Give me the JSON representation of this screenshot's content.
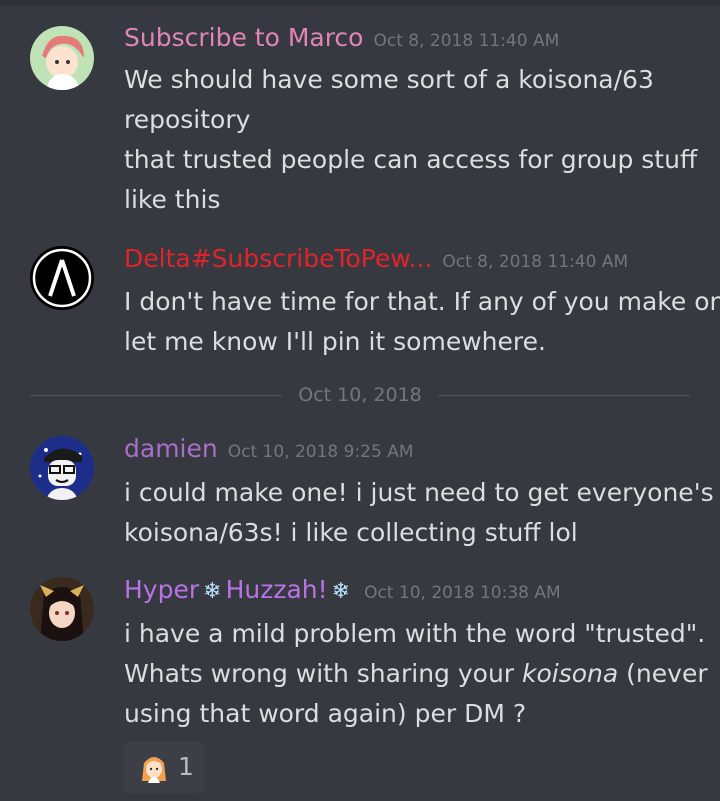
{
  "messages": [
    {
      "username": "Subscribe to Marco",
      "username_color": "#e184b7",
      "timestamp": "Oct 8, 2018 11:40 AM",
      "lines": [
        "We should have some sort of a koisona/63",
        "repository",
        "that trusted people can access for group stuff",
        "like this"
      ]
    },
    {
      "username": "Delta#SubscribeToPew...",
      "username_color": "#e0242a",
      "timestamp": "Oct 8, 2018 11:40 AM",
      "lines": [
        "I don't have time for that. If any of you make one",
        "let me know I'll pin it somewhere."
      ]
    },
    {
      "username": "damien",
      "username_color": "#a86fc9",
      "timestamp": "Oct 10, 2018 9:25 AM",
      "lines": [
        "i could make one! i just need to get everyone's",
        "koisona/63s! i like collecting stuff lol"
      ]
    },
    {
      "username_parts": [
        "Hyper",
        "Huzzah!"
      ],
      "username_color": "#b873e5",
      "username_icon": "snowflake-icon",
      "timestamp": "Oct 10, 2018 10:38 AM",
      "line1": "i have a mild problem with the word \"trusted\".",
      "line2_pre": "Whats wrong with sharing your ",
      "line2_em": "koisona",
      "line2_post": " (never",
      "line3": "using that word again) per DM ?",
      "reaction": {
        "emoji": "girl-emoji",
        "count": "1"
      }
    }
  ],
  "date_divider": "Oct 10, 2018",
  "colors": {
    "background": "#36393f",
    "text": "#dcddde",
    "timestamp": "#72767d"
  }
}
